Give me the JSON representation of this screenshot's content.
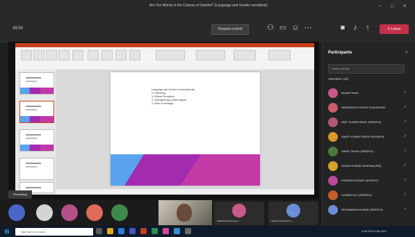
{
  "window": {
    "title": "Are Our Words in the Classes of Gender? (Language and Gender sensitivity)"
  },
  "toolbar": {
    "time": "49:54",
    "request_control": "Request control",
    "leave": "Leave"
  },
  "presentation": {
    "slide_heading": "Language and Gender in everyday talk:",
    "slide_bullets": [
      "Offending",
      "Ethical Perception",
      "Strengthening of stereotypes",
      "Rate of message"
    ],
    "colors": {
      "band_blue": "#5aa3ef",
      "band_purple": "#a22bb0",
      "band_magenta": "#c23aa6",
      "ribbon_accent": "#c43e1c"
    },
    "presenter_label": "Presenting"
  },
  "participants": {
    "title": "Participants",
    "search_placeholder": "Search people",
    "section": "Attendees (32)",
    "people": [
      {
        "name": "Mohak Pandit",
        "color": "#c85a8a"
      },
      {
        "name": "DEBASMITA GHOSH CHAUDHURI",
        "color": "#c95b6b"
      },
      {
        "name": "AMIT KUMAR BISAL (SRIDEVI)",
        "color": "#b35679"
      },
      {
        "name": "SAMIT KUMAR SINGH (SRIDEVI)",
        "color": "#d89a2a"
      },
      {
        "name": "SAMIT YADAV (SRIDEVI)",
        "color": "#4c7a3c"
      },
      {
        "name": "ARJUN KUMAR SHARMA (SRI)",
        "color": "#d4a42a"
      },
      {
        "name": "KRISHNA KUMAR (SRIDEVI)",
        "color": "#b8489a"
      },
      {
        "name": "SURBHI RAJ (SRIDEVI)",
        "color": "#c25e2e"
      },
      {
        "name": "DEVANANDA KUMAR (SRIDEVI)",
        "color": "#6a8fd6"
      }
    ]
  },
  "bottom": {
    "avatar_colors": [
      "#4a66c9",
      "#d4d4d4",
      "#b74f8a",
      "#e06b5a",
      "#3f8a4a"
    ],
    "tiles": [
      {
        "name": "DEBASMITA GHOSH C...",
        "color": "#c85a8a"
      },
      {
        "name": "SURAJIT SARKAR R...",
        "color": "#6a8fd6"
      }
    ]
  },
  "taskbar": {
    "search_placeholder": "Type here to search",
    "time": "4:56 PM",
    "date": "20-08-2021"
  }
}
